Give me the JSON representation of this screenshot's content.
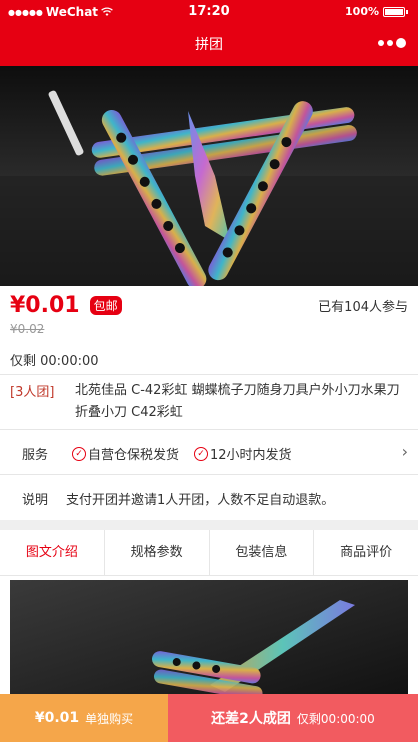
{
  "status_bar": {
    "carrier": "WeChat",
    "time": "17:20",
    "battery": "100%"
  },
  "nav": {
    "title": "拼团"
  },
  "product": {
    "price": "¥0.01",
    "free_shipping": "包邮",
    "participants": "已有104人参与",
    "original_price": "¥0.02",
    "remaining": "仅剩 00:00:00",
    "group_tag": "[3人团]",
    "title": "北苑佳品 C-42彩虹 蝴蝶梳子刀随身刀具户外小刀水果刀折叠小刀 C42彩虹"
  },
  "service": {
    "label": "服务",
    "items": [
      "自营仓保税发货",
      "12小时内发货"
    ]
  },
  "notice": {
    "label": "说明",
    "text": "支付开团并邀请1人开团，人数不足自动退款。"
  },
  "tabs": [
    "图文介绍",
    "规格参数",
    "包装信息",
    "商品评价"
  ],
  "bottom_bar": {
    "solo_price": "¥0.01",
    "solo_label": "单独购买",
    "group_label": "还差2人成团",
    "group_timer": "仅剩00:00:00"
  },
  "colors": {
    "brand_red": "#e60012",
    "solo_orange": "#f5a64a",
    "group_pink": "#f25b60"
  }
}
